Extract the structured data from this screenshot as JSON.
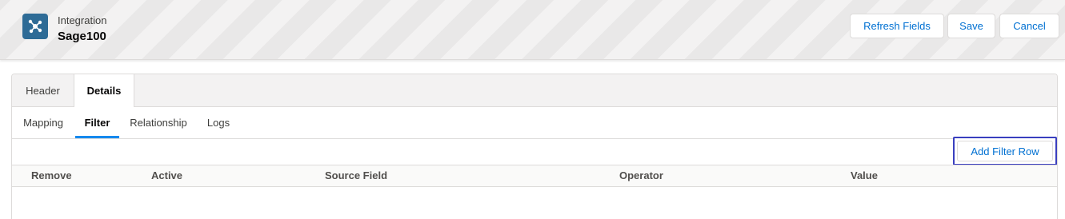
{
  "header": {
    "object_label": "Integration",
    "record_name": "Sage100",
    "icon": "integration-network-icon",
    "icon_color": "#2e6b96",
    "buttons": {
      "refresh": "Refresh Fields",
      "save": "Save",
      "cancel": "Cancel"
    }
  },
  "tabs": [
    {
      "label": "Header",
      "active": false
    },
    {
      "label": "Details",
      "active": true
    }
  ],
  "subtabs": [
    {
      "label": "Mapping",
      "active": false
    },
    {
      "label": "Filter",
      "active": true
    },
    {
      "label": "Relationship",
      "active": false
    },
    {
      "label": "Logs",
      "active": false
    }
  ],
  "filter": {
    "add_row_label": "Add Filter Row",
    "columns": [
      "Remove",
      "Active",
      "Source Field",
      "Operator",
      "Value"
    ]
  },
  "colors": {
    "brand_link": "#0070d2",
    "active_tab_indicator": "#1589ee",
    "focus_outline": "#3a3fbf"
  }
}
